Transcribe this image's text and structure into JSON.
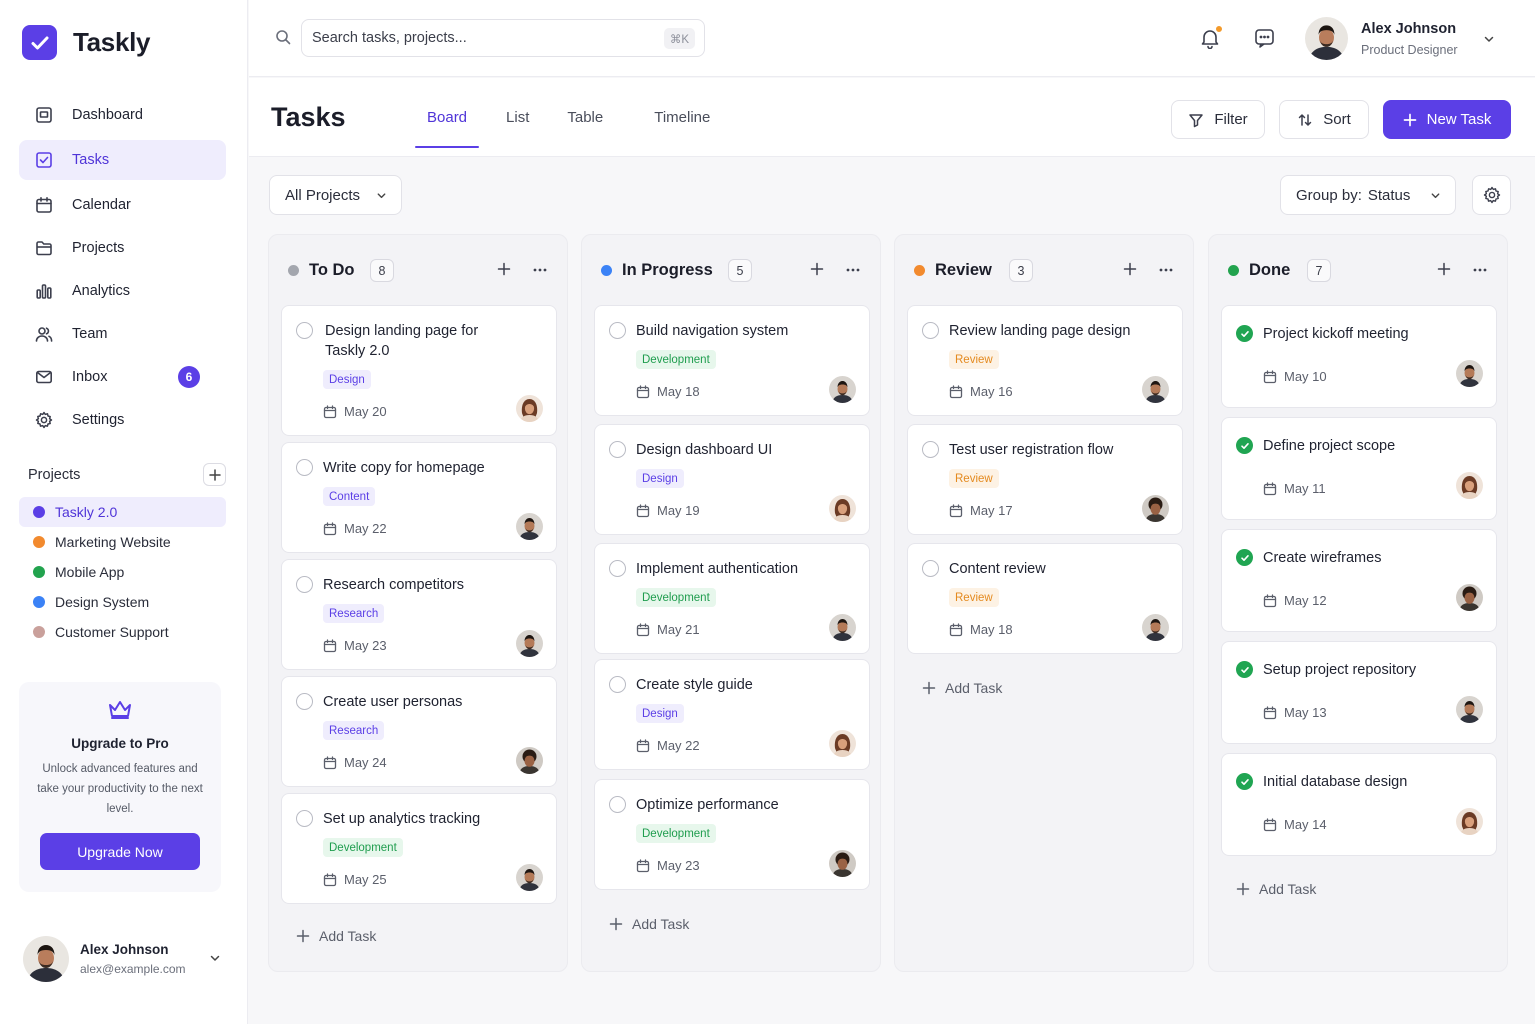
{
  "app": {
    "name": "Taskly"
  },
  "sidebar": {
    "nav": [
      {
        "label": "Dashboard",
        "icon": "dashboard-icon"
      },
      {
        "label": "Tasks",
        "icon": "tasks-icon",
        "active": true
      },
      {
        "label": "Calendar",
        "icon": "calendar-icon"
      },
      {
        "label": "Projects",
        "icon": "folder-icon"
      },
      {
        "label": "Analytics",
        "icon": "bar-chart-icon"
      },
      {
        "label": "Team",
        "icon": "users-icon"
      },
      {
        "label": "Inbox",
        "icon": "mail-icon",
        "badge": "6"
      },
      {
        "label": "Settings",
        "icon": "gear-icon"
      }
    ],
    "projects_heading": "Projects",
    "projects": [
      {
        "label": "Taskly 2.0",
        "color": "#5b3fe6",
        "active": true
      },
      {
        "label": "Marketing Website",
        "color": "#f28a2e"
      },
      {
        "label": "Mobile App",
        "color": "#22a34e"
      },
      {
        "label": "Design System",
        "color": "#3b82f6"
      },
      {
        "label": "Customer Support",
        "color": "#c9a09b"
      }
    ],
    "promo": {
      "title": "Upgrade to Pro",
      "text": "Unlock advanced features and take your productivity to the next level.",
      "button": "Upgrade Now"
    },
    "user": {
      "name": "Alex Johnson",
      "email": "alex@example.com"
    }
  },
  "topbar": {
    "search_placeholder": "Search tasks, projects...",
    "search_shortcut": "⌘K",
    "user": {
      "name": "Alex Johnson",
      "role": "Product Designer"
    }
  },
  "header": {
    "title": "Tasks",
    "tabs": [
      {
        "label": "Board",
        "active": true
      },
      {
        "label": "List"
      },
      {
        "label": "Table"
      },
      {
        "label": "Timeline"
      }
    ],
    "filter_label": "Filter",
    "sort_label": "Sort",
    "new_task_label": "New Task"
  },
  "toolbar": {
    "project_filter": "All Projects",
    "group_by_label": "Group by:",
    "group_by_value": "Status"
  },
  "colors": {
    "accent": "#5b3fe6"
  },
  "board": {
    "add_task_label": "Add Task",
    "columns": [
      {
        "title": "To Do",
        "count": "8",
        "color": "#a3a6ae",
        "cards": [
          {
            "title": "Design landing page for Taskly 2.0",
            "tag": "Design",
            "tag_type": "design",
            "date": "May 20",
            "avatar": "woman"
          },
          {
            "title": "Write copy for homepage",
            "tag": "Content",
            "tag_type": "content",
            "date": "May 22",
            "avatar": "man"
          },
          {
            "title": "Research competitors",
            "tag": "Research",
            "tag_type": "research",
            "date": "May 23",
            "avatar": "man"
          },
          {
            "title": "Create user personas",
            "tag": "Research",
            "tag_type": "research",
            "date": "May 24",
            "avatar": "curly"
          },
          {
            "title": "Set up analytics tracking",
            "tag": "Development",
            "tag_type": "development",
            "date": "May 25",
            "avatar": "man"
          }
        ]
      },
      {
        "title": "In Progress",
        "count": "5",
        "color": "#3b82f6",
        "cards": [
          {
            "title": "Build navigation system",
            "tag": "Development",
            "tag_type": "development",
            "date": "May 18",
            "avatar": "man"
          },
          {
            "title": "Design dashboard UI",
            "tag": "Design",
            "tag_type": "design",
            "date": "May 19",
            "avatar": "woman"
          },
          {
            "title": "Implement authentication",
            "tag": "Development",
            "tag_type": "development",
            "date": "May 21",
            "avatar": "man"
          },
          {
            "title": "Create style guide",
            "tag": "Design",
            "tag_type": "design",
            "date": "May 22",
            "avatar": "woman"
          },
          {
            "title": "Optimize performance",
            "tag": "Development",
            "tag_type": "development",
            "date": "May 23",
            "avatar": "curly"
          }
        ]
      },
      {
        "title": "Review",
        "count": "3",
        "color": "#f28a2e",
        "cards": [
          {
            "title": "Review landing page design",
            "tag": "Review",
            "tag_type": "review",
            "date": "May 16",
            "avatar": "man"
          },
          {
            "title": "Test user registration flow",
            "tag": "Review",
            "tag_type": "review",
            "date": "May 17",
            "avatar": "curly"
          },
          {
            "title": "Content review",
            "tag": "Review",
            "tag_type": "review",
            "date": "May 18",
            "avatar": "man"
          }
        ]
      },
      {
        "title": "Done",
        "count": "7",
        "color": "#22a34e",
        "cards": [
          {
            "title": "Project kickoff meeting",
            "date": "May 10",
            "avatar": "man",
            "done": true
          },
          {
            "title": "Define project scope",
            "date": "May 11",
            "avatar": "woman",
            "done": true
          },
          {
            "title": "Create wireframes",
            "date": "May 12",
            "avatar": "curly",
            "done": true
          },
          {
            "title": "Setup project repository",
            "date": "May 13",
            "avatar": "man",
            "done": true
          },
          {
            "title": "Initial database design",
            "date": "May 14",
            "avatar": "woman",
            "done": true
          }
        ]
      }
    ]
  }
}
